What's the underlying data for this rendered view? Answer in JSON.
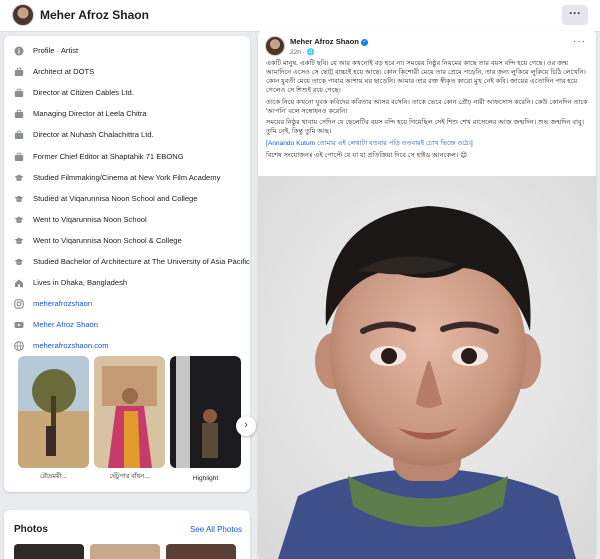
{
  "header": {
    "name": "Meher Afroz Shaon",
    "more_label": "···"
  },
  "intro": {
    "items": [
      {
        "icon": "info-icon",
        "text": "Profile · Artist",
        "link": false
      },
      {
        "icon": "briefcase-icon",
        "text": "Architect at DOTS",
        "link": false
      },
      {
        "icon": "briefcase-icon",
        "text": "Director at Citizen Cables Ltd.",
        "link": false
      },
      {
        "icon": "briefcase-icon",
        "text": "Managing Director at Leela Chitra",
        "link": false
      },
      {
        "icon": "briefcase-icon",
        "text": "Director at Nuhash Chalachittra Ltd.",
        "link": false
      },
      {
        "icon": "briefcase-icon",
        "text": "Former Chief Editor at Shaptahik 71 EBONG",
        "link": false
      },
      {
        "icon": "graduation-cap-icon",
        "text": "Studied Filmmaking/Cinema at New York Film Academy",
        "link": false
      },
      {
        "icon": "graduation-cap-icon",
        "text": "Studied at Viqarunnisa Noon School and College",
        "link": false
      },
      {
        "icon": "graduation-cap-icon",
        "text": "Went to Viqarunnisa Noon School",
        "link": false
      },
      {
        "icon": "graduation-cap-icon",
        "text": "Went to Viqarunnisa Noon School & College",
        "link": false
      },
      {
        "icon": "graduation-cap-icon",
        "text": "Studied Bachelor of Architecture at The University of Asia Pacific",
        "link": false
      },
      {
        "icon": "home-icon",
        "text": "Lives in Dhaka, Bangladesh",
        "link": false
      },
      {
        "icon": "instagram-icon",
        "text": "meherafrozshaon",
        "link": true
      },
      {
        "icon": "youtube-icon",
        "text": "Meher Afroz Shaon",
        "link": true
      },
      {
        "icon": "globe-icon",
        "text": "meherafrozshaon.com",
        "link": true
      }
    ]
  },
  "highlights": {
    "items": [
      {
        "label": "রৌদ্রময়ী..."
      },
      {
        "label": "ঘেঁটুপার বাঁধন..."
      },
      {
        "label": "Highlight"
      }
    ],
    "next_label": "›"
  },
  "photos": {
    "title": "Photos",
    "see_all": "See All Photos"
  },
  "post": {
    "author": "Meher Afroz Shaon",
    "time": "22h · 🌐",
    "more_label": "···",
    "paragraphs": [
      "একটি মানুষ, একটি ছবি। যে আর কখনোই বড় হবে না। সময়ের নিষ্ঠুর নিয়মের কাছে তার বয়স বন্দি হয়ে গেছে। ওর জন্ম আমাদিনে এসেও সে ছোট্ট বাচ্চাই হয়ে আছে। কোন কিশোরী মেয়ে তার প্রেমে পড়েনি, তার জন্য লুকিয়ে লুকিয়ে চিঠি লেখেনি। কোন যুবতী মেয়ে তাকে পাবার আশায় ঘর ছাড়েনি। আমার তার রক্ত স্বীকৃত কারো মুখ নেই কবি। জায়ের এতোদিন পার হয়ে গেলেও সে শিশুই রয়ে গেছে।",
      "তাকে নিয়ে কখনো যুবক কবিদের কবিতার আসর বসেনি। তাকে ভেবে কোন প্রৌঢ় নারী আফসোস করেনি। কেউ কোনদিন তাকে 'আপনি' বলে সম্বোধনও করেনি।",
      "সময়ের নিষ্ঠুর থাবায় সেদিন যে ছেলেটির বয়স বন্দি হয়ে গিয়েছিল সেই শিশু শেখ রাসেলের আজ জন্মদিন। শুভ জন্মদিন বাবু। তুমি নেই, কিন্তু তুমি আছ।",
      "[Annando Kutum তোমার এই লেখাটা যতবার পড়ি ততবারই চোখ ভিজে ওঠে।]",
      "বিশেষ সংযোজনঃ এই পোস্টে যে যা যা প্রতিক্রিয়া দিবে সে হাইড আনকেল। 😊"
    ]
  }
}
